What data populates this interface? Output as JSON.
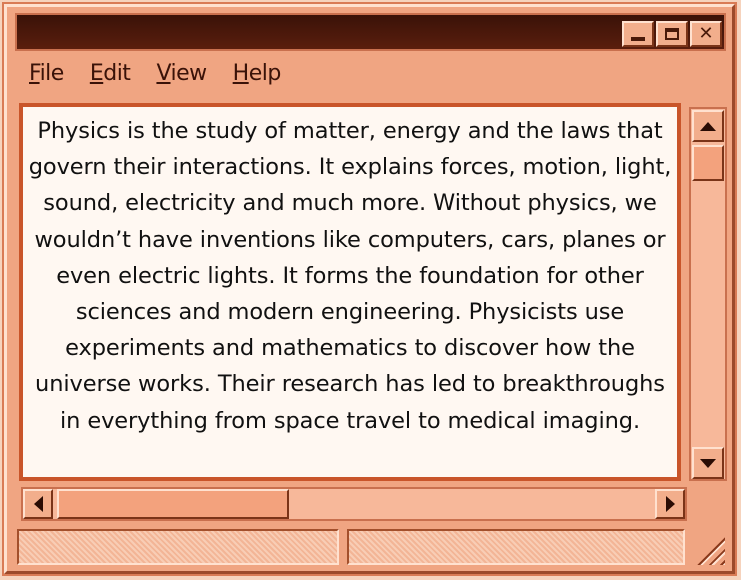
{
  "window": {
    "title": "",
    "controls": {
      "minimize_icon": "minimize-icon",
      "maximize_icon": "maximize-icon",
      "close_icon": "close-icon",
      "close_glyph": "✕"
    }
  },
  "menu": [
    {
      "u": "F",
      "rest": "ile"
    },
    {
      "u": "E",
      "rest": "dit"
    },
    {
      "u": "V",
      "rest": "iew"
    },
    {
      "u": "H",
      "rest": "elp"
    }
  ],
  "document": {
    "text": "Physics is the study of matter, energy and the laws that govern their interactions. It explains forces, motion, light, sound, electricity and much more. Without physics, we wouldn’t have inventions like computers, cars, planes or even electric lights. It forms the foundation for other sciences and modern engineering. Physicists use experiments and mathematics to discover how the universe works. Their research has led to breakthroughs in everything from space travel to medical imaging."
  },
  "status": {
    "pane_1": "",
    "pane_2": ""
  },
  "colors": {
    "window_bg": "#f0a582",
    "titlebar": "#3a1208",
    "text_bg": "#fff8f2",
    "accent_border": "#c9552a"
  }
}
